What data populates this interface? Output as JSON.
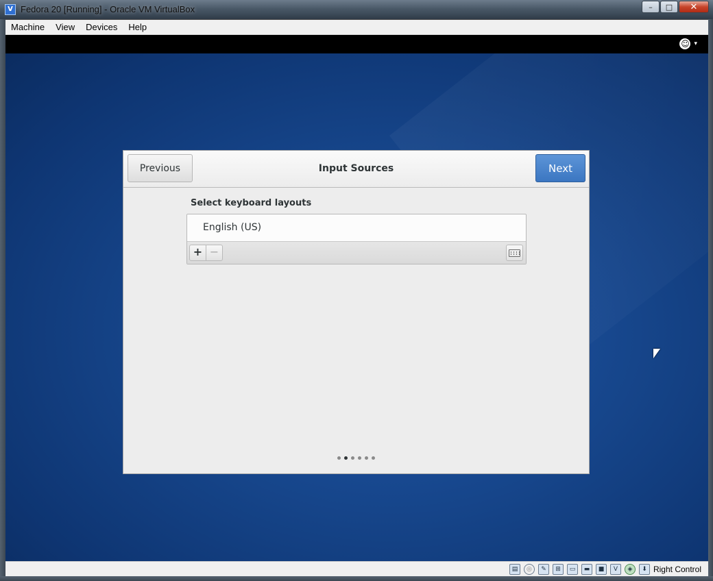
{
  "window": {
    "title": "Fedora 20 [Running] - Oracle VM VirtualBox",
    "icon": "virtualbox-icon",
    "controls": {
      "minimize": "–",
      "maximize": "□",
      "close": "✕"
    }
  },
  "menubar": {
    "items": [
      "Machine",
      "View",
      "Devices",
      "Help"
    ]
  },
  "guest_topbar": {
    "accessibility_icon": "accessibility-icon",
    "caret": "▾"
  },
  "dialog": {
    "previous_label": "Previous",
    "title": "Input Sources",
    "next_label": "Next",
    "accent": "#4a86cf",
    "section_label": "Select keyboard layouts",
    "layouts": [
      "English (US)"
    ],
    "toolbar": {
      "add": "+",
      "remove": "−",
      "keyboard_icon": "keyboard-icon"
    },
    "pager": {
      "total": 6,
      "active_index": 1
    }
  },
  "statusbar": {
    "icons": [
      "hard-disk-icon",
      "optical-drive-icon",
      "usb-icon",
      "network-icon",
      "shared-folders-icon",
      "display-icon",
      "video-capture-icon",
      "virtualization-icon",
      "mouse-integration-icon",
      "host-key-icon"
    ],
    "host_key_label": "Right Control"
  }
}
